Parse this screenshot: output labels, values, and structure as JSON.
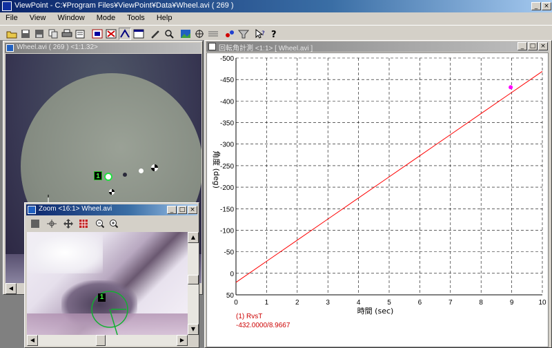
{
  "app": {
    "title": "ViewPoint - C:¥Program Files¥ViewPoint¥Data¥Wheel.avi ( 269 )",
    "window_buttons": [
      "_",
      "□",
      "×"
    ]
  },
  "menu": [
    "File",
    "View",
    "Window",
    "Mode",
    "Tools",
    "Help"
  ],
  "toolbar": {
    "icons": [
      "open-folder-icon",
      "save-icon",
      "save-as-icon",
      "copy-icon",
      "print-icon",
      "print-setup-icon",
      "capture-icon",
      "delete-icon",
      "track-icon",
      "view-icon",
      "pen-icon",
      "magnify-icon",
      "image-icon",
      "target-icon",
      "calibrate-icon",
      "marker-icon",
      "filter-icon",
      "help-cursor-icon",
      "help-icon"
    ]
  },
  "video_window": {
    "title": "Wheel.avi ( 269 ) <1:1.32>",
    "marker_label": "1"
  },
  "zoom_window": {
    "title": "Zoom <16:1> Wheel.avi",
    "marker_label": "1",
    "tools": [
      "stop-icon",
      "crosshair-icon",
      "move-icon",
      "grid-icon",
      "zoom-out-icon",
      "zoom-in-icon"
    ]
  },
  "graph_window": {
    "title": "回転角計測 <1:1> [ Wheel.avi ]",
    "legend_line1": "(1) RvsT",
    "legend_line2": "-432.0000/8.9667"
  },
  "colors": {
    "desktop": "#808080",
    "chrome": "#d4d0c8",
    "title_active": "#0a246a",
    "trace": "#ff0000",
    "cursor_point": "#ff00ff",
    "legend_text": "#cc0000"
  },
  "chart_data": {
    "type": "line",
    "xlabel": "時間 (sec)",
    "ylabel": "角度 (deg)",
    "xlim": [
      0,
      10
    ],
    "ylim": [
      50,
      -500
    ],
    "xticks": [
      0,
      1,
      2,
      3,
      4,
      5,
      6,
      7,
      8,
      9,
      10
    ],
    "yticks": [
      50,
      0,
      -50,
      -100,
      -150,
      -200,
      -250,
      -300,
      -350,
      -400,
      -450,
      -500
    ],
    "grid": true,
    "series": [
      {
        "name": "(1) RvsT",
        "x": [
          0,
          1,
          2,
          3,
          4,
          5,
          6,
          7,
          8,
          9,
          10
        ],
        "y": [
          21,
          -28,
          -77,
          -126,
          -175,
          -224,
          -273,
          -322,
          -371,
          -420,
          -469
        ]
      }
    ],
    "cursor": {
      "x": 8.9667,
      "y": -432.0
    }
  }
}
